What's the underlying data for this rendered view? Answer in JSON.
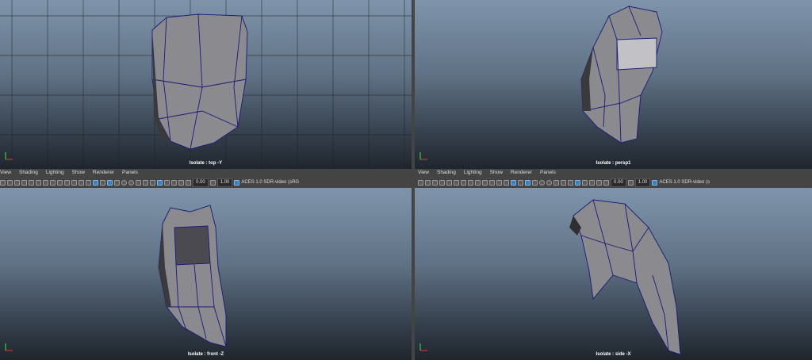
{
  "menus": [
    "View",
    "Shading",
    "Lighting",
    "Show",
    "Renderer",
    "Panels"
  ],
  "toolbar": {
    "exposure": "0.00",
    "gamma": "1.00",
    "color_space_left": "ACES 1.0 SDR-video (sRG",
    "color_space_right": "ACES 1.0 SDR-video (s"
  },
  "viewports": {
    "top": {
      "label": "Isolate : top -Y"
    },
    "persp": {
      "label": "Isolate : persp1"
    },
    "front": {
      "label": "Isolate : front -Z"
    },
    "side": {
      "label": "Isolate : side -X"
    }
  },
  "colors": {
    "wire": "#1a1a7a",
    "mesh": "#8a8a8f"
  },
  "icons": [
    "camera-icon",
    "grid-icon",
    "wireframe-icon",
    "shaded-icon",
    "textured-icon",
    "lights-icon",
    "shadows-icon",
    "isolate-icon",
    "color-management-icon"
  ]
}
